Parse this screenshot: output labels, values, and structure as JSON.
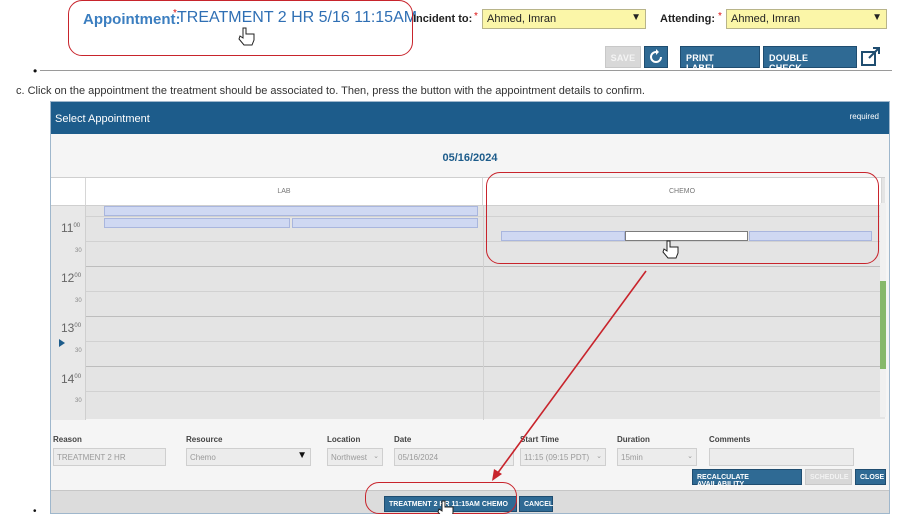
{
  "form": {
    "appointment_label": "Appointment:",
    "appointment_value": "TREATMENT 2 HR 5/16 11:15AM",
    "incident_label": "Incident to:",
    "incident_value": "Ahmed, Imran",
    "attending_label": "Attending:",
    "attending_value": "Ahmed, Imran",
    "required_mark": "*"
  },
  "toolbar": {
    "save_label": "SAVE",
    "refresh_icon": "refresh-icon",
    "print_label": "PRINT LABEL...",
    "double_check_label": "DOUBLE CHECK...",
    "popout_icon": "external-link-icon"
  },
  "instruction": {
    "bullet": "•",
    "text": "c. Click on the appointment the treatment should be associated to. Then, press the button with the appointment details to confirm."
  },
  "modal": {
    "title": "Select Appointment",
    "required_note": "required",
    "date": "05/16/2024",
    "columns": [
      "LAB",
      "CHEMO"
    ],
    "hours": [
      {
        "hour": "11",
        "sup": "00",
        "half": "30"
      },
      {
        "hour": "12",
        "sup": "00",
        "half": "30"
      },
      {
        "hour": "13",
        "sup": "00",
        "half": "30"
      },
      {
        "hour": "14",
        "sup": "00",
        "half": "30"
      }
    ]
  },
  "details": {
    "reason_label": "Reason",
    "reason_value": "TREATMENT 2 HR",
    "resource_label": "Resource",
    "resource_value": "Chemo",
    "location_label": "Location",
    "location_value": "Northwest",
    "date_label": "Date",
    "date_value": "05/16/2024",
    "start_label": "Start Time",
    "start_value": "11:15 (09:15 PDT)",
    "duration_label": "Duration",
    "duration_value": "15min",
    "comments_label": "Comments",
    "comments_value": ""
  },
  "actions": {
    "recalculate_label": "RECALCULATE AVAILABILITY",
    "schedule_label": "SCHEDULE",
    "close_label": "CLOSE",
    "confirm_label": "TREATMENT 2 HR 11:15AM CHEMO",
    "cancel_label": "CANCEL"
  },
  "colors": {
    "header_blue": "#1d5c8b",
    "button_blue": "#2f6a94",
    "annotation_red": "#c8242c",
    "required_yellow": "#fbf6a8",
    "slot_blue": "#cfd8f2"
  }
}
